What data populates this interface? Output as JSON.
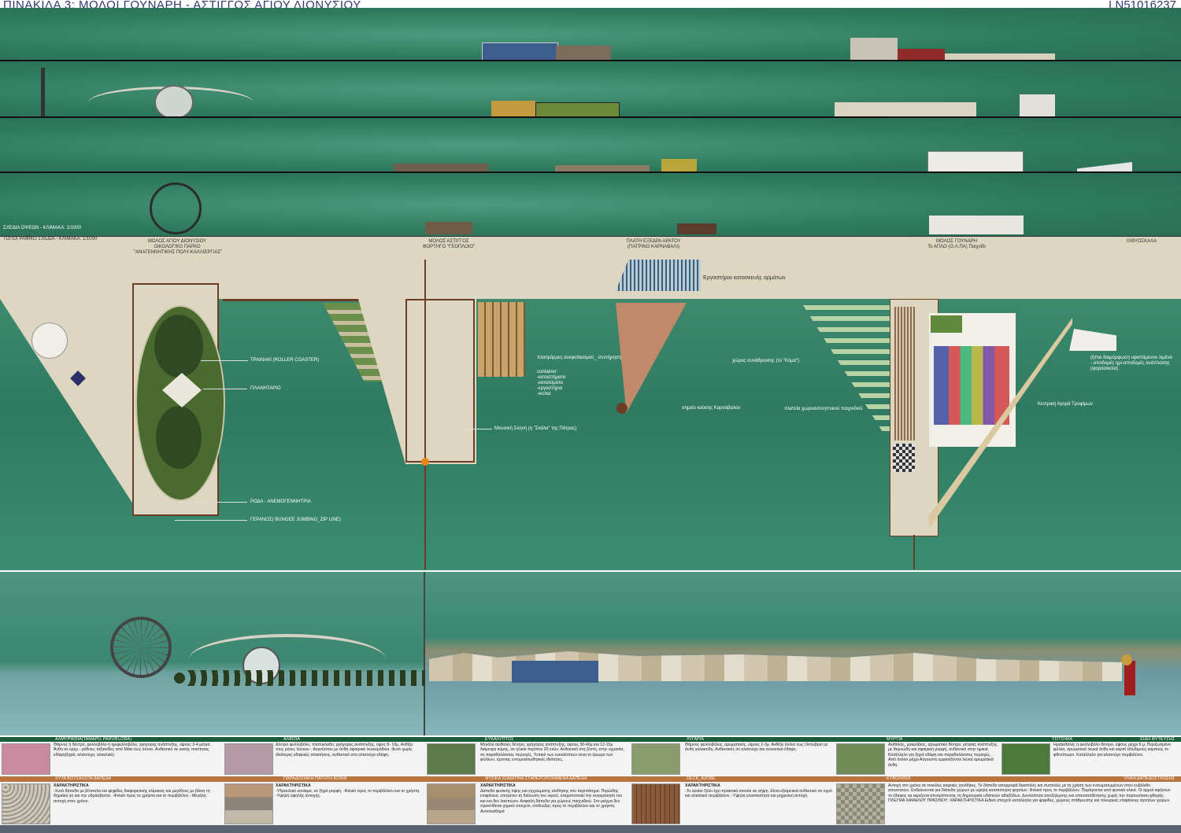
{
  "header": {
    "title": "ΠΙΝΑΚΙΔΑ 3: ΜΟΛΟΙ ΓΟΥΝΑΡΗ - ΑΣΤΙΓΓΟΣ ΑΓΙΟΥ ΔΙΟΝΥΣΙΟΥ",
    "code": "LN51016237"
  },
  "sections": {
    "elevations_label": "ΣΧΕΔΙΑ ΟΨΕΩΝ - ΚΛΙΜΑΚΑ: 1/1000",
    "plan_label": "ΤΟΠΟΓΡΑΦΙΚΟ ΣΧΕΔΙΑ - ΚΛΙΜΑΚΑ: 1/1000"
  },
  "plan": {
    "zones": {
      "agios_dionysios": {
        "title": "ΜΟΛΟΣ ΑΓΙΟΥ ΔΙΟΝΥΣΙΟΥ",
        "sub1": "ΟΙΚΟΛΟΓΙΚΟ ΠΑΡΚΟ",
        "sub2": "\"ΑΝΑΓΕΝΝΗΤΙΚΗΣ ΠΟΛΥ-ΚΑΛΛΙΕΡΓΙΑΣ\""
      },
      "astiggos": {
        "title": "ΜΟΛΟΣ ΑΣΤΙΓΓΟΣ",
        "sub1": "ΦΟΡΤΗΓΟ \"ΓΕΟΠΛΟΙΟ\""
      },
      "exedra": {
        "title": "ΠΛΑΤΗ ΕΞΕΔΡΑ ΑΡΑΤΟΥ",
        "sub1": "(ΠΑΤΡΙΝΟ ΚΑΡΝΑΒΑΛΙ)"
      },
      "gounari": {
        "title": "ΜΟΛΟΣ ΓΟΥΝΑΡΗ",
        "sub1": "Το ΑΠΛΟ (Ο.Λ.ΠΑ) Παιχνίδι"
      },
      "ichthyoskala": {
        "title": "ΙΧΘΥΟΣΚΑΛΑ"
      }
    },
    "labels": {
      "roller": "ΤΡΑΙΝΑΚΙ (ROLLER COASTER)",
      "planetarium": "ΠΛΑΝΗΤΑΡΙΟ",
      "wheel": "ΡΟΔΑ - ΑΝΕΜΟΓΕΝΝΗΤΡΙΑ",
      "crane": "ΓΕΡΑΝΟΣ( BUNGEE JUMBING_ZIP LINE)",
      "workshops": "Εργαστήρια κατασκευής αρμάτων",
      "gathering": "χώρος συνάθροισης (το \"Κύμα\")",
      "burning": "σημείο καύσης Καρνάβαλου",
      "floating": "πλατεία χωροαντιληπτικού παιχνιδιού",
      "market": "Κεντρική Αγορά Τροφίμων",
      "platforms": "πλατφόρμες ανεφοδιασμού_ συντήρησης σκαφών",
      "containers1": "container:",
      "containers2": "-καταστήματα",
      "containers3": "-καταλύματα",
      "containers4": "-εργαστήρια",
      "containers5": "-wc/κα",
      "stage": "Μουσική Σκηνή (η \"Σκάλα\" της Πάτρας)",
      "port1": "(ήπια διαμόρφωση υφιστάμενου λιμένα",
      "port2": "- αποδομές ημι-αποδομές ανάπλασης",
      "port3": "(ψαρόσκαλα)"
    }
  },
  "legend": {
    "plants_label": "ΕΙΔΗ ΦΥΤΕΥΣΗΣ",
    "plants": [
      {
        "name": "ΑΛΜΥΡΙΚΘΙΑ(ΤΑΜΑΡΙΞ PARVIFLORA)",
        "text": "Θάμνος ή δέντρο, φυλλοβόλο ή ημιφυλλοβόλο, γρήγορης ανάπτυξης, ύψους 3-4 μέτρα. Άνθη σε κρέμ - ρόδινες ταξιανθίες από Μάιο έως Ιούνιο. Ανθεκτικό σε κακής ποιότητας εδάφη(ξηρά, αλατούχα, αλκαλικά)."
      },
      {
        "name": "ΑΛΒΙΖΙΑ",
        "text": "Δέντρο φυλλοβόλο, πλατυκλαδο, γρήγορης ανάπτυξης, ύψος 8- 10μ. Ανθίζει τους μήνες Ιουνιου - Αυγούστου με άνθη σφαιρικά λευκορόδινα. Φυτό χωρίς ιδιαίτερες εδαφικές απαιτήσεις, ανθεκτικό στα αλατούχα εδάφη."
      },
      {
        "name": "ΕΥΚΑΛΥΠΤΟΣ",
        "text": "Μεγάλο αειθαλές δέντρο, γρήγορης ανάπτυξης, ύψους 30-40μ και 12-15μ διάμετρο κόμης, σε ηλικία περίπου 20 ετών. Ανθεκτικό στη ζέστη, στην υγρασία, σε παραθαλάσσιες περιοχές. Τυπικό των ευκαλύπτων είναι το άρωμα των φύλλων, έχοντας εντομοαπωθητικές ιδιότητες."
      },
      {
        "name": "ΛΥΓΑΡΙΑ",
        "text": "Θάμνος φυλλοβόλος, αρωματικός, ύψους 2-3μ. Ανθίζει Ιούλιο έως Οκτώβριο με άνθη γαλακτιδη. Ανθεκτικός σε αλατούχο και συνεκτικό έδαφη."
      },
      {
        "name": "ΜΥΡΤΙΑ",
        "text": "Αειθαλής, μακρόβιος, αρωματικό δέντρο, μέτριας ανάπτυξης, με θαμνώδη και σφαιρική μορφή, ανθεκτικό στην ημικιά. Κατάλληλο για ξηρά εδάφη και παραθαλάσσιες περιοχές. Από Ιούνιο μέχρι Αύγουστο εμφανίζονται λευκά αρωματικά άνθη."
      },
      {
        "name": "ΤΣΙΤΣΙΦΙΑ",
        "text": "Ημιαειθαλές ή φυλλοβόλο δέντρο, ύψους μέχρι 6 μ. Περιζωσμένο φύλλα, αρωματικά λευκά άνθη και καρπί εδώδιμους καρπούς το φθινόπωρο. Κατάλληλο για αλατούχο περιβάλλον."
      }
    ],
    "materials_label": "ΥΛΙΚΑ ΔΑΠΕΔΟΣΤΡΩΣΗΣ",
    "materials": [
      {
        "name": "ΧΥΤΑ ΒΟΤΣΑΛΩΤΑ ΔΑΠΕΔΑ",
        "head": "ΧΑΡΑΚΤΗΡΙΣΤΙΚΑ",
        "text": "-Χυτά δάπεδα με βότσαλα και ψηφίδες διαφορετικής κλίμακας και μεγέθους με βάση τη θηριάκή γη και την υδράσβεστο. -Φιλικό προς το χρήστη και το περιβάλλον. -Μεγάλη αντοχή στον χρόνο."
      },
      {
        "name": "ΠΑΡΑΔΟΣΙΑΚΗ ΠΑΤΗΤΗ ΚΟΝΙΑ",
        "head": "ΧΑΡΑΚΤΗΡΙΣΤΙΚΑ",
        "text": "-Υδραυλικό κονίαμα, σε ξηρό μορφή. -Φιλικό προς το περιβάλλον και το χρήστη. -Υψηλή υψηλής αντοχής."
      },
      {
        "name": "ΦΥΣΙΚΑ ΧΩΜΑΤΙΝΑ ΣΤΑΘΕΡΟΠΟΙΗΜΕΝΑ ΔΑΠΕΔΑ",
        "head": "ΧΑΡΑΚΤΗΡΙΣΤΙΚΑ",
        "text": "Δάπεδα φυσικής όψης και εγχρώματης αίσθησης στο περιπάτημα. Πορώδης επιφάνεια, επιτρέπει τη διέλευση του νερού, ελαχιστοποιεί την συγκράτησή του και και δεν λασπώνει. Ασφαλή δάπεδα για χώρους παιχνιδιού. Στο μείγμα δεν προστίθεται χημικό στοιχείο, επιδιώξεις προς το περιβάλλον και το χρήστη. Αντιολισθηρά"
      },
      {
        "name": "DECK_A2OBE",
        "head": "ΧΑΡΑΚΤΗΡΙΣΤΙΚΑ",
        "text": "-Το αzobe ξύλο έχει πρακτικά ανοσία σε σήψη. Είναι εξαιρετικά ανθεκτικό σε υγρό και αλκαλικό περιβάλλον. -Υψηλή ελαστικότητα και μηχανική αντοχή."
      },
      {
        "name": "ΚΥΒΟΛΙΘΟΙ",
        "head": "",
        "text": "Αντοχή στο χρόνο σε ποικίλες καιρικές συνθήκες. Το δάπεδο απορροφά διαστολές και συστολές με τη χρήση των ενσωματωμένων στον κυβόλιθο αποστατών. Ενδείκνυνται για δάπεδα χώρων με υψηλή καταπόνηση φορτίων. Φιλικοί προς το περιβάλλον. Παράγονται από φυσικά υλικά. Οι αρμοί αφήνουν το έδαφος να αεριζεται αποτρέποντας τη δημιουργία υδάτινων αδιεξόδων. Δυνατότητα αποξήλωσης και επαναποθέτησης χωρίς την παρουσίαση φθοράς. ΠΛΕΓΜΑ ΧΑΜΗΛΟΥ ΠΡΑΣΙΝΟΥ: ΧΑΡΑΚΤΗΡΙΣΤΙΚΑ Ειδικό στοιχείο κατάλληλο για ψηφίδες, χώρους στάθμευσης και πλευρικές επιφάνειες αγνητών χώρων."
      }
    ]
  },
  "colors": {
    "sea": "#2f7a60",
    "quay": "#ddd6c0",
    "pier_brown": "#6b3d24",
    "legend_bar": "#1a5b3a",
    "materials_bar": "#b9743f"
  }
}
